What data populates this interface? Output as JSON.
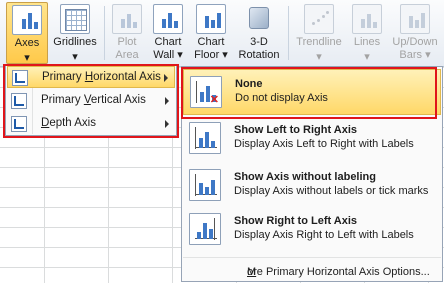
{
  "ribbon": {
    "axes": {
      "label": "Axes"
    },
    "gridlines": {
      "label": "Gridlines"
    },
    "plot_area": {
      "line1": "Plot",
      "line2": "Area"
    },
    "chart_wall": {
      "line1": "Chart",
      "line2": "Wall"
    },
    "chart_floor": {
      "line1": "Chart",
      "line2": "Floor"
    },
    "rotation": {
      "line1": "3-D",
      "line2": "Rotation"
    },
    "trendline": {
      "label": "Trendline"
    },
    "lines": {
      "label": "Lines"
    },
    "updown": {
      "line1": "Up/Down",
      "line2": "Bars"
    }
  },
  "submenu": {
    "items": [
      {
        "label_pre": "Primary ",
        "label_u": "H",
        "label_post": "orizontal Axis"
      },
      {
        "label_pre": "Primary ",
        "label_u": "V",
        "label_post": "ertical Axis"
      },
      {
        "label_pre": "",
        "label_u": "D",
        "label_post": "epth Axis"
      }
    ]
  },
  "dropdown": {
    "items": [
      {
        "title": "None",
        "desc": "Do not display Axis"
      },
      {
        "title": "Show Left to Right Axis",
        "desc": "Display Axis Left to Right with Labels"
      },
      {
        "title": "Show Axis without labeling",
        "desc": "Display Axis without labels or tick marks"
      },
      {
        "title": "Show Right to Left Axis",
        "desc": "Display Axis Right to Left with Labels"
      }
    ],
    "footer_pre": "",
    "footer_u": "M",
    "footer_post": "ore Primary Horizontal Axis Options..."
  }
}
